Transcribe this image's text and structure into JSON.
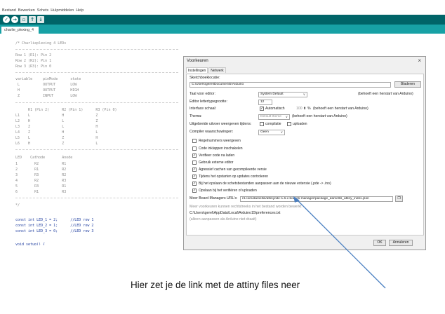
{
  "menu": [
    "Bestand",
    "Bewerken",
    "Schets",
    "Hulpmiddelen",
    "Help"
  ],
  "toolbar_icons": [
    "verify-icon",
    "upload-icon",
    "new-icon",
    "open-icon",
    "save-icon"
  ],
  "tab_label": "charlie_plexing_4",
  "code": {
    "header": "/* Charlieplexing 4 LEDs",
    "rows": [
      "Row 1 (R1): Pin 2",
      "Row 2 (R2): Pin 1",
      "Row 3 (R3): Pin 0"
    ],
    "table1": [
      "variable     pinMode      state",
      " L           OUTPUT       LOW",
      " H           OUTPUT       HIGH",
      " Z           INPUT        LOW"
    ],
    "table2_head": "      R1 (Pin 2)      R2 (Pin 1)      R3 (Pin 0)",
    "table2": [
      "L1    L               H               Z",
      "L2    H               L               Z",
      "L3    Z               L               H",
      "L4    Z               H               L",
      "L5    L               Z               H",
      "L6    H               Z               L"
    ],
    "table3": [
      "LED    Cathode        Anode",
      "1        R2           R1",
      "2        R1           R2",
      "3        R3           R2",
      "4        R2           R3",
      "5        R3           R1",
      "6        R1           R3"
    ],
    "end_comment": "*/",
    "consts": [
      "const int LED_1 = 2;      //LED row 1",
      "const int LED_2 = 1;      //LED row 2",
      "const int LED_3 = 0;      //LED row 3"
    ],
    "last": "void setup() {"
  },
  "dialog": {
    "title": "Voorkeuren",
    "tabs": [
      "Instellingen",
      "Netwerk"
    ],
    "sketchbook_label": "Sketchboeklocatie:",
    "sketchbook_path": "C:\\Users\\gerel\\Documents\\Arduino",
    "browse_button": "Bladeren",
    "editor_language_label": "Taal voor editor:",
    "editor_language_value": "System Default",
    "restart_note": "(behoeft een herstart van Arduino)",
    "font_size_label": "Editor lettertypegrootte:",
    "font_size_value": "12",
    "interface_scale_label": "Interface schaal:",
    "automatic_label": "Automatisch",
    "scale_value": "100",
    "scale_unit": "%",
    "scale_note": "(behoeft een herstart van Arduino)",
    "theme_label": "Thema:",
    "theme_value": "Default theme",
    "theme_note": "(behoeft een herstart van Arduino)",
    "verbose_label": "Uitgebreide uitvoer weergeven tijdens:",
    "compile_label": "compilatie",
    "upload_label": "uploaden",
    "warnings_label": "Compiler waarschuwingen:",
    "warnings_value": "Geen",
    "options": [
      {
        "label": "Regelnummers weergeven",
        "checked": false
      },
      {
        "label": "Code inklappen inschakelen",
        "checked": false
      },
      {
        "label": "Verifieer code na laden",
        "checked": true
      },
      {
        "label": "Gebruik externe editor",
        "checked": false
      },
      {
        "label": "Agressief cachen van gecompileerde versie",
        "checked": true
      },
      {
        "label": "Tijdens het opstarten op updates controleren",
        "checked": true
      },
      {
        "label": "Bij het opslaan de schetsbestanden aanpassen aan de nieuwe extensie (.pde -> .ino)",
        "checked": true
      },
      {
        "label": "Opslaan bij het verifiëren of uploaden",
        "checked": true
      }
    ],
    "board_urls_label": "Meer Board Managers URL's:",
    "board_urls_value": "nt.com/damellis/attiny/ide-1.6.x-boards-manager/package_damellis_attiny_index.json",
    "hint1": "Meer voorkeuren kunnen rechtstreeks in het bestand worden bewerkt",
    "prefs_path": "C:\\Users\\gerel\\AppData\\Local\\Arduino15\\preferences.txt",
    "hint2": "(alleen aanpassen als Arduino niet draait)",
    "ok_button": "OK",
    "cancel_button": "Annuleren"
  },
  "annotation": "Hier zet je de link met de attiny files neer",
  "colors": {
    "toolbar": "#006468",
    "tabbar": "#17a1a5",
    "arrow": "#4a7fc1"
  }
}
